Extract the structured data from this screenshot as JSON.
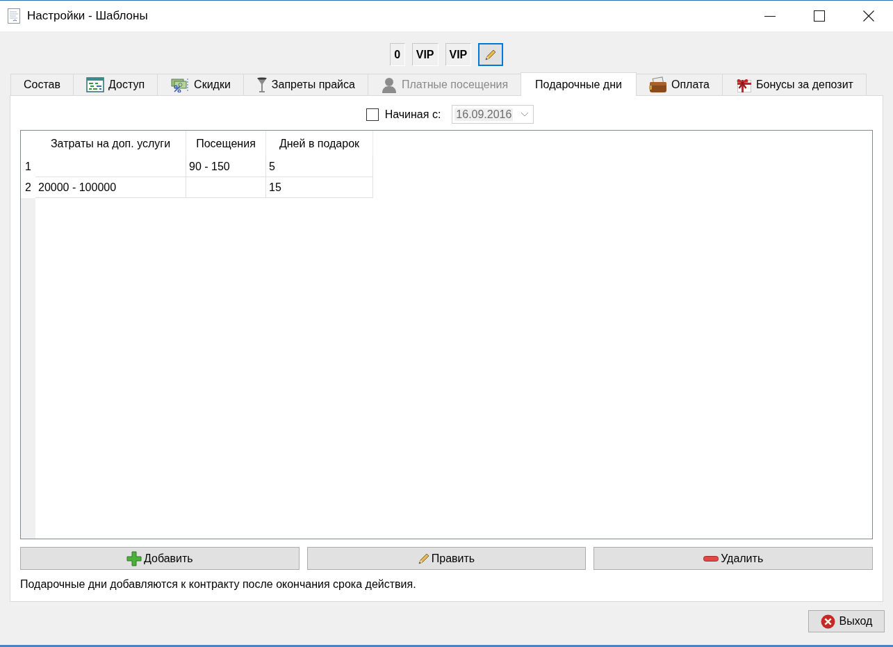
{
  "window": {
    "title": "Настройки - Шаблоны"
  },
  "toolbar": [
    {
      "kind": "text",
      "label": "0",
      "selected": false
    },
    {
      "kind": "text",
      "label": "VIP",
      "selected": false
    },
    {
      "kind": "text",
      "label": "VIP",
      "selected": false
    },
    {
      "kind": "pencil",
      "selected": true
    }
  ],
  "tabs": [
    {
      "label": "Состав",
      "selected": false,
      "disabled": false
    },
    {
      "label": "Доступ",
      "selected": false,
      "disabled": false
    },
    {
      "label": "Скидки",
      "selected": false,
      "disabled": false
    },
    {
      "label": "Запреты прайса",
      "selected": false,
      "disabled": false
    },
    {
      "label": "Платные посещения",
      "selected": false,
      "disabled": true
    },
    {
      "label": "Подарочные дни",
      "selected": true,
      "disabled": false
    },
    {
      "label": "Оплата",
      "selected": false,
      "disabled": false
    },
    {
      "label": "Бонусы за депозит",
      "selected": false,
      "disabled": false
    }
  ],
  "start_date": {
    "label": "Начиная с:",
    "checked": false,
    "value": "16.09.2016",
    "disabled": true
  },
  "table": {
    "columns": [
      "Затраты на доп. услуги",
      "Посещения",
      "Дней в подарок"
    ],
    "rows": [
      {
        "number": "1",
        "cells": [
          null,
          "90 - 150",
          "5"
        ]
      },
      {
        "number": "2",
        "cells": [
          "20000 - 100000",
          null,
          "15"
        ]
      }
    ]
  },
  "buttons": [
    {
      "kind": "add",
      "label": "Добавить"
    },
    {
      "kind": "edit",
      "label": "Править"
    },
    {
      "kind": "delete",
      "label": "Удалить"
    }
  ],
  "note": "Подарочные дни добавляются к контракту после окончания срока действия.",
  "exit_button": {
    "label": "Выход"
  }
}
